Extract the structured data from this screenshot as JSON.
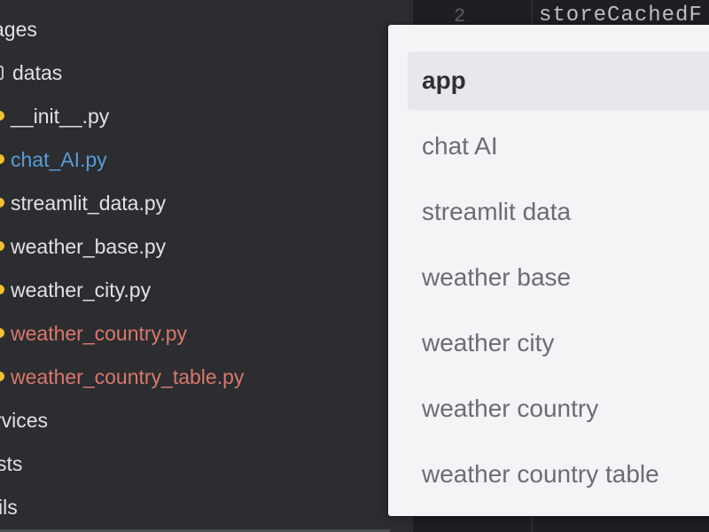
{
  "tree": {
    "items": [
      {
        "label": "ages",
        "color": "normal",
        "icon": "none"
      },
      {
        "label": "datas",
        "color": "normal",
        "icon": "folder-bracket-icon"
      },
      {
        "label": "__init__.py",
        "color": "normal",
        "icon": "python-file-icon"
      },
      {
        "label": "chat_AI.py",
        "color": "blue",
        "icon": "python-file-icon"
      },
      {
        "label": "streamlit_data.py",
        "color": "normal",
        "icon": "python-file-icon"
      },
      {
        "label": "weather_base.py",
        "color": "normal",
        "icon": "python-file-icon"
      },
      {
        "label": "weather_city.py",
        "color": "normal",
        "icon": "python-file-icon"
      },
      {
        "label": "weather_country.py",
        "color": "red",
        "icon": "python-file-icon"
      },
      {
        "label": "weather_country_table.py",
        "color": "red",
        "icon": "python-file-icon"
      },
      {
        "label": "rvices",
        "color": "normal",
        "icon": "none"
      },
      {
        "label": "sts",
        "color": "normal",
        "icon": "none"
      },
      {
        "label": "ils",
        "color": "normal",
        "icon": "none"
      }
    ]
  },
  "editor": {
    "line_number": "2",
    "code": "storeCachedF"
  },
  "popup": {
    "items": [
      {
        "label": "app",
        "selected": true
      },
      {
        "label": "chat AI",
        "selected": false
      },
      {
        "label": "streamlit data",
        "selected": false
      },
      {
        "label": "weather base",
        "selected": false
      },
      {
        "label": "weather city",
        "selected": false
      },
      {
        "label": "weather country",
        "selected": false
      },
      {
        "label": "weather country table",
        "selected": false
      }
    ]
  },
  "colors": {
    "tree_bg": "#2b2d30",
    "editor_bg": "#1e1f22",
    "popup_bg": "#f3f4f6",
    "selected_bg": "#e6e8ec",
    "text_normal": "#dfe1e5",
    "text_blue": "#5a9bd6",
    "text_red": "#d9776c",
    "python_dot": "#f2c12e"
  }
}
